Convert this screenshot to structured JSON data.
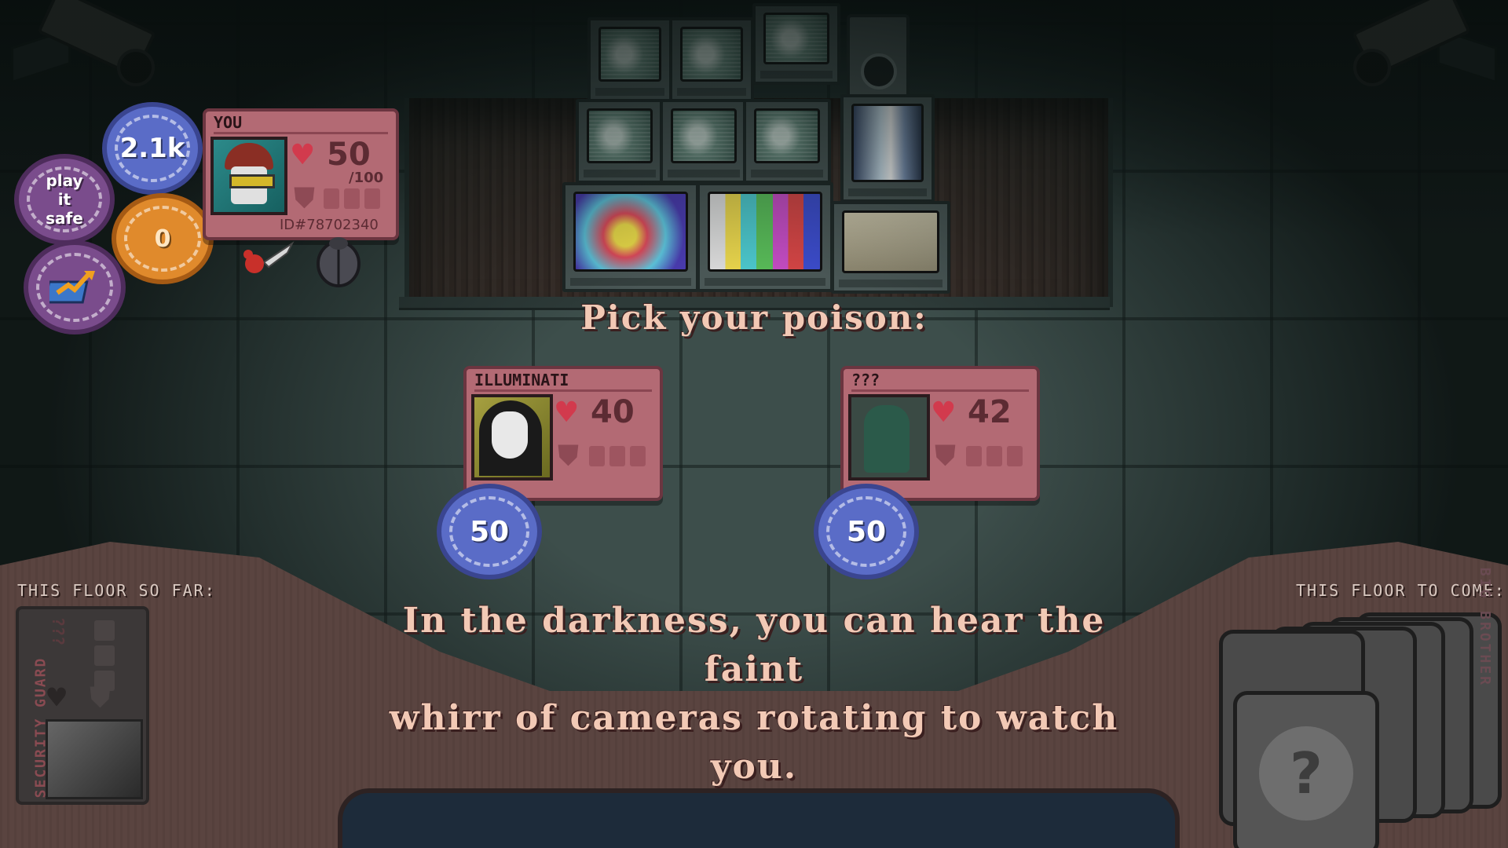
{
  "prompt": "Pick your poison:",
  "narration_line1": "In the darkness, you can hear the faint",
  "narration_line2": "whirr of cameras rotating to watch you.",
  "player": {
    "name": "YOU",
    "hp": "50",
    "hp_max": "/100",
    "id": "ID#78702340",
    "money_chip": "2.1k",
    "strategy_chip": "play it safe",
    "counter_chip": "0",
    "stats_icon": "chart-book-icon",
    "items": [
      "knife-icon",
      "beetle-icon"
    ]
  },
  "choices": [
    {
      "name": "ILLUMINATI",
      "hp": "40",
      "bet": "50"
    },
    {
      "name": "???",
      "hp": "42",
      "bet": "50"
    }
  ],
  "history": {
    "label": "THIS FLOOR SO FAR:",
    "card_name": "SECURITY GUARD",
    "card_hp": "???"
  },
  "upcoming": {
    "label": "THIS FLOOR TO COME:",
    "boss_name": "BIG BROTHER",
    "mystery_symbol": "?"
  },
  "colors": {
    "card": "#b36a74",
    "text_accent": "#f2c9b5",
    "chip_blue": "#5a6cc7",
    "chip_orange": "#e08a2c",
    "chip_purple": "#7a4c8c"
  }
}
